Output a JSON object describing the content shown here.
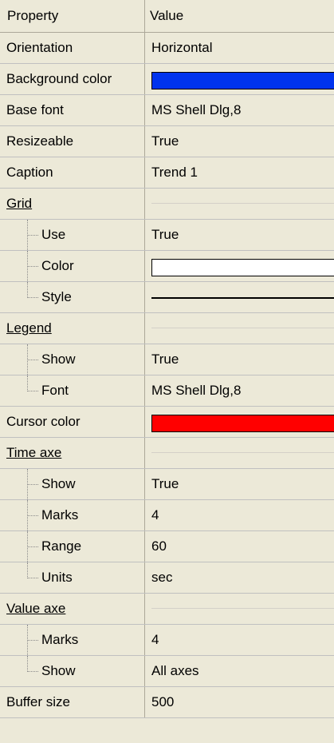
{
  "header": {
    "col1": "Property",
    "col2": "Value"
  },
  "rows": [
    {
      "id": "orientation",
      "label": "Orientation",
      "value": "Horizontal"
    },
    {
      "id": "background-color",
      "label": "Background color",
      "value": "",
      "color": "#0033ee"
    },
    {
      "id": "base-font",
      "label": "Base font",
      "value": "MS Shell Dlg,8"
    },
    {
      "id": "resizeable",
      "label": "Resizeable",
      "value": "True"
    },
    {
      "id": "caption",
      "label": "Caption",
      "value": "Trend 1"
    },
    {
      "id": "grid",
      "label": "Grid",
      "group": true
    },
    {
      "id": "grid-use",
      "label": "Use",
      "value": "True",
      "child": true
    },
    {
      "id": "grid-color",
      "label": "Color",
      "value": "",
      "color": "#ffffff",
      "child": true
    },
    {
      "id": "grid-style",
      "label": "Style",
      "value": "",
      "line": true,
      "child": true,
      "last": true
    },
    {
      "id": "legend",
      "label": "Legend",
      "group": true
    },
    {
      "id": "legend-show",
      "label": "Show",
      "value": "True",
      "child": true
    },
    {
      "id": "legend-font",
      "label": "Font",
      "value": "MS Shell Dlg,8",
      "child": true,
      "last": true
    },
    {
      "id": "cursor-color",
      "label": "Cursor color",
      "value": "",
      "color": "#ff0000"
    },
    {
      "id": "time-axe",
      "label": "Time axe",
      "group": true
    },
    {
      "id": "time-show",
      "label": "Show",
      "value": "True",
      "child": true
    },
    {
      "id": "time-marks",
      "label": "Marks",
      "value": "4",
      "child": true
    },
    {
      "id": "time-range",
      "label": "Range",
      "value": "60",
      "child": true
    },
    {
      "id": "time-units",
      "label": "Units",
      "value": "sec",
      "child": true,
      "last": true
    },
    {
      "id": "value-axe",
      "label": "Value axe",
      "group": true
    },
    {
      "id": "value-marks",
      "label": "Marks",
      "value": "4",
      "child": true
    },
    {
      "id": "value-show",
      "label": "Show",
      "value": "All axes",
      "child": true,
      "last": true
    },
    {
      "id": "buffer-size",
      "label": "Buffer size",
      "value": "500"
    }
  ]
}
